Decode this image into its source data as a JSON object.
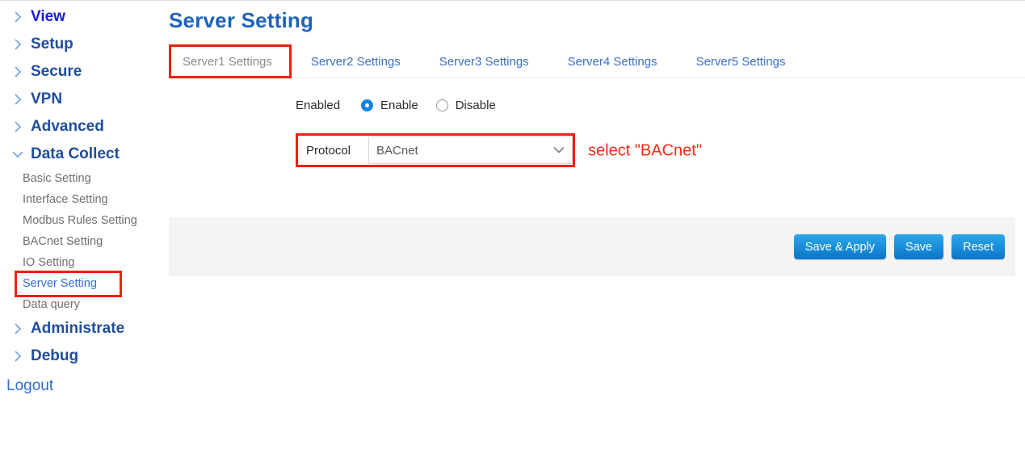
{
  "sidebar": {
    "groups": [
      {
        "label": "View",
        "expanded": false,
        "accent": true,
        "children": []
      },
      {
        "label": "Setup",
        "expanded": false,
        "accent": false,
        "children": []
      },
      {
        "label": "Secure",
        "expanded": false,
        "accent": false,
        "children": []
      },
      {
        "label": "VPN",
        "expanded": false,
        "accent": false,
        "children": []
      },
      {
        "label": "Advanced",
        "expanded": false,
        "accent": false,
        "children": []
      },
      {
        "label": "Data Collect",
        "expanded": true,
        "accent": false,
        "children": [
          {
            "label": "Basic Setting",
            "active": false,
            "highlighted": false
          },
          {
            "label": "Interface Setting",
            "active": false,
            "highlighted": false
          },
          {
            "label": "Modbus Rules Setting",
            "active": false,
            "highlighted": false
          },
          {
            "label": "BACnet Setting",
            "active": false,
            "highlighted": false
          },
          {
            "label": "IO Setting",
            "active": false,
            "highlighted": false
          },
          {
            "label": "Server Setting",
            "active": true,
            "highlighted": true
          },
          {
            "label": "Data query",
            "active": false,
            "highlighted": false
          }
        ]
      },
      {
        "label": "Administrate",
        "expanded": false,
        "accent": false,
        "children": []
      },
      {
        "label": "Debug",
        "expanded": false,
        "accent": false,
        "children": []
      }
    ],
    "logout_label": "Logout"
  },
  "main": {
    "page_title": "Server Setting",
    "tabs": [
      {
        "label": "Server1 Settings",
        "active": true,
        "highlighted": true
      },
      {
        "label": "Server2 Settings",
        "active": false,
        "highlighted": false
      },
      {
        "label": "Server3 Settings",
        "active": false,
        "highlighted": false
      },
      {
        "label": "Server4 Settings",
        "active": false,
        "highlighted": false
      },
      {
        "label": "Server5 Settings",
        "active": false,
        "highlighted": false
      }
    ],
    "form": {
      "enabled_label": "Enabled",
      "enable_option": "Enable",
      "disable_option": "Disable",
      "enabled_value": "Enable",
      "protocol_label": "Protocol",
      "protocol_value": "BACnet",
      "protocol_options": [
        "BACnet"
      ],
      "annotation": "select \"BACnet\""
    },
    "buttons": {
      "save_apply": "Save & Apply",
      "save": "Save",
      "reset": "Reset"
    }
  },
  "colors": {
    "annotation_red": "#f42b18",
    "highlight_box_red": "#f01f10",
    "nav_blue": "#1f4e9c",
    "nav_accent_blue": "#1a1ae0",
    "link_blue": "#2f6fd0",
    "title_blue": "#1f63b8",
    "tab_blue": "#3c6fc4",
    "tab_active_gray": "#8b8b8b",
    "radio_blue": "#1283e6",
    "panel_gray": "#f4f4f4",
    "button_blue_top": "#2fa7e8",
    "button_blue_bottom": "#0d74c6"
  }
}
